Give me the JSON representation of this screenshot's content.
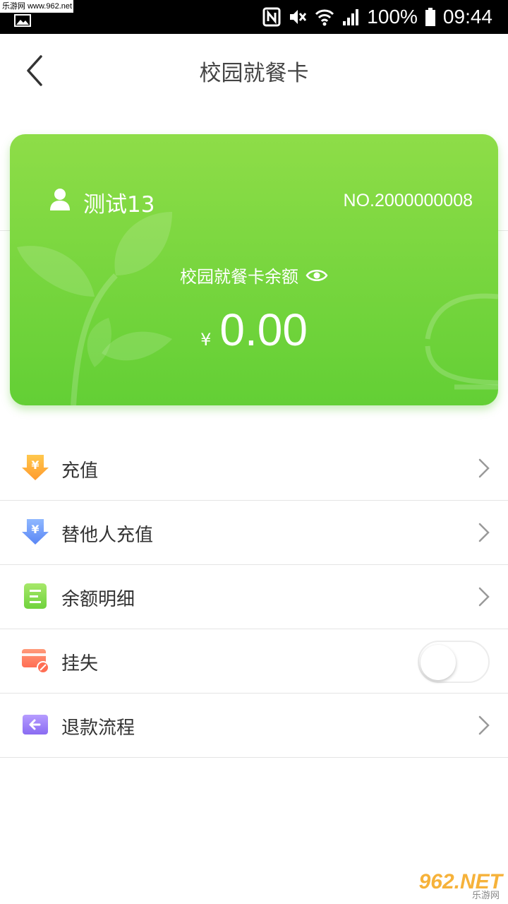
{
  "status_bar": {
    "watermark_text": "乐游网 www.962.net",
    "battery": "100%",
    "time": "09:44"
  },
  "header": {
    "title": "校园就餐卡",
    "back_icon": "chevron-left-icon"
  },
  "card": {
    "user_name": "测试13",
    "card_number": "NO.2000000008",
    "balance_label": "校园就餐卡余额",
    "currency": "¥",
    "amount": "0.00",
    "accent_color": "#63cf35"
  },
  "menu": {
    "items": [
      {
        "label": "充值",
        "icon": "recharge-icon",
        "control": "chevron"
      },
      {
        "label": "替他人充值",
        "icon": "recharge-others-icon",
        "control": "chevron"
      },
      {
        "label": "余额明细",
        "icon": "list-icon",
        "control": "chevron"
      },
      {
        "label": "挂失",
        "icon": "card-lock-icon",
        "control": "toggle",
        "toggle_on": false
      },
      {
        "label": "退款流程",
        "icon": "refund-icon",
        "control": "chevron"
      }
    ]
  },
  "watermark": {
    "logo_text": "962.NET",
    "logo_sub": "乐游网"
  }
}
